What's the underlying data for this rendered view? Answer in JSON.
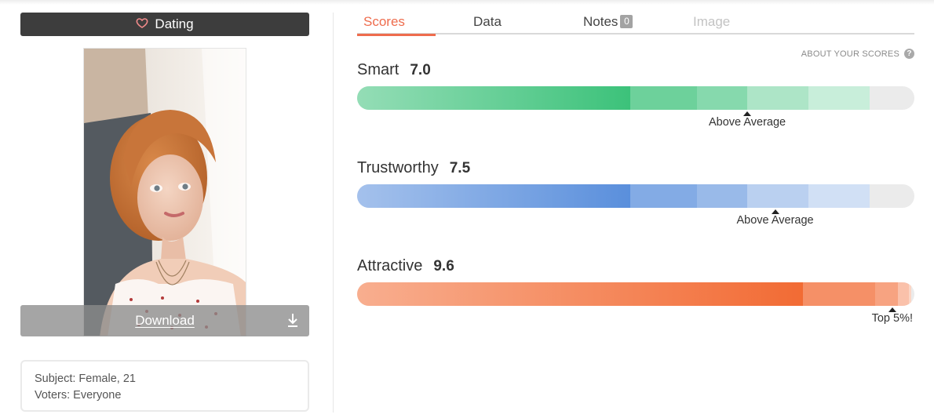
{
  "left": {
    "category": {
      "label": "Dating",
      "icon": "heart-icon"
    },
    "photo": {
      "alt": ""
    },
    "download": {
      "label": "Download",
      "icon": "download-icon"
    },
    "info": {
      "subject": "Subject: Female, 21",
      "voters": "Voters: Everyone"
    }
  },
  "tabs": [
    {
      "label": "Scores",
      "state": "active"
    },
    {
      "label": "Data",
      "state": "normal"
    },
    {
      "label": "Notes",
      "badge": "0",
      "state": "normal"
    },
    {
      "label": "Image",
      "state": "disabled"
    }
  ],
  "about_label": "ABOUT YOUR SCORES",
  "scores": [
    {
      "name": "Smart",
      "value": "7.0",
      "rating": "Above Average",
      "fill": 0.7,
      "color": "#3cc27a"
    },
    {
      "name": "Trustworthy",
      "value": "7.5",
      "rating": "Above Average",
      "fill": 0.75,
      "color": "#5a8fdc"
    },
    {
      "name": "Attractive",
      "value": "9.6",
      "rating": "Top 5%!",
      "fill": 0.96,
      "color": "#f26b34"
    }
  ]
}
